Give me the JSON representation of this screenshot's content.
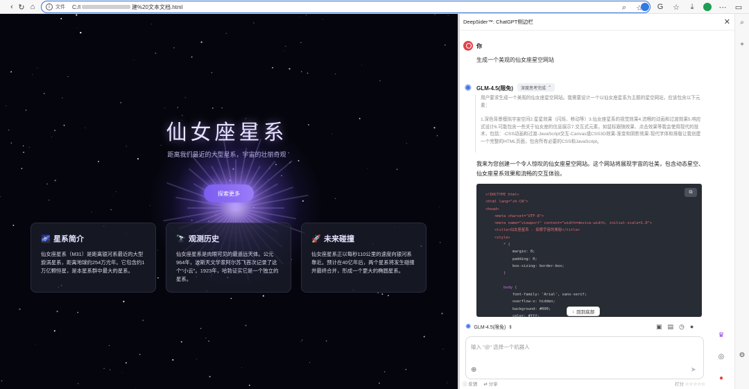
{
  "browser": {
    "file_label": "文件",
    "url_prefix": "C:/l",
    "url_suffix": "建%20文本文档.html"
  },
  "galaxy": {
    "title": "仙女座星系",
    "subtitle": "距离我们最近的大型星系，宇宙的壮丽奇观",
    "button": "探索更多",
    "cards": [
      {
        "icon": "🌌",
        "title": "星系简介",
        "body": "仙女座星系（M31）是距离银河系最近的大型旋涡星系，距离地球约254万光年。它包含约1万亿颗恒星，是本星系群中最大的星系。"
      },
      {
        "icon": "🔭",
        "title": "观测历史",
        "body": "仙女座星系是肉眼可见的最遥远天体。公元964年，波斯天文学家阿尔苏飞首次记录了这个\"小云\"。1923年，哈勃证实它是一个独立的星系。"
      },
      {
        "icon": "🚀",
        "title": "未来碰撞",
        "body": "仙女座星系正以每秒110公里的速度向银河系靠近。预计在40亿年后，两个星系将发生碰撞并最终合并，形成一个更大的椭圆星系。"
      }
    ]
  },
  "panel": {
    "title": "DeepSider™: ChatGPT侧边栏",
    "user_name": "你",
    "user_message": "生成一个美观的仙女座星空网站",
    "bot_name": "GLM-4.5(限免)",
    "think_tag": "深度思考完成",
    "thoughts": [
      "用户要求生成一个美观的仙女座星空网站。我需要设计一个以仙女座星系为主题的星空网站，应该包含以下元素：",
      "1.深色背景模拟宇宙空间2.星星效果（闪烁、移动等）3.仙女座星系的视觉效果4.流畅的动画和过渡效果5.响应式设计6.可能包含一些关于仙女座的信息展示7.交互式元素，如鼠标跟随效果、点击效果等我会使用现代的技术，包括：-CSS动画和过渡-JavaScript交互-Canvas或CSS3D效果-渐变和阴影效果-现代字体和排版让我创建一个完整的HTML页面，包含所有必要的CSS和JavaScript。"
    ],
    "reply": "我来为您创建一个令人惊叹的仙女座星空网站。这个网站将展现宇宙的壮美，包含动态星空、仙女座星系效果和流畅的交互体验。",
    "code_lines": [
      "<!DOCTYPE html>",
      "<html lang=\"zh-CN\">",
      "<head>",
      "    <meta charset=\"UTF-8\">",
      "    <meta name=\"viewport\" content=\"width=device-width, initial-scale=1.0\">",
      "    <title>仙女座星系 - 探索宇宙的奥秘</title>",
      "    <style>",
      "        * {",
      "            margin: 0;",
      "            padding: 0;",
      "            box-sizing: border-box;",
      "        }",
      "",
      "        body {",
      "            font-family: 'Arial', sans-serif;",
      "            overflow-x: hidden;",
      "            background: #000;",
      "            color: #fff;"
    ],
    "back_bottom": "回到底部",
    "model_selector": "GLM-4.5(限免)",
    "input_placeholder": "输入 \"@\" 选择一个机器人",
    "footer_feedback": "反馈",
    "footer_share": "分享",
    "footer_rate": "打分"
  },
  "colors": {
    "accent": "#7b5cf0",
    "address_border": "#2f6fd6",
    "user_avatar": "#e0454b"
  }
}
